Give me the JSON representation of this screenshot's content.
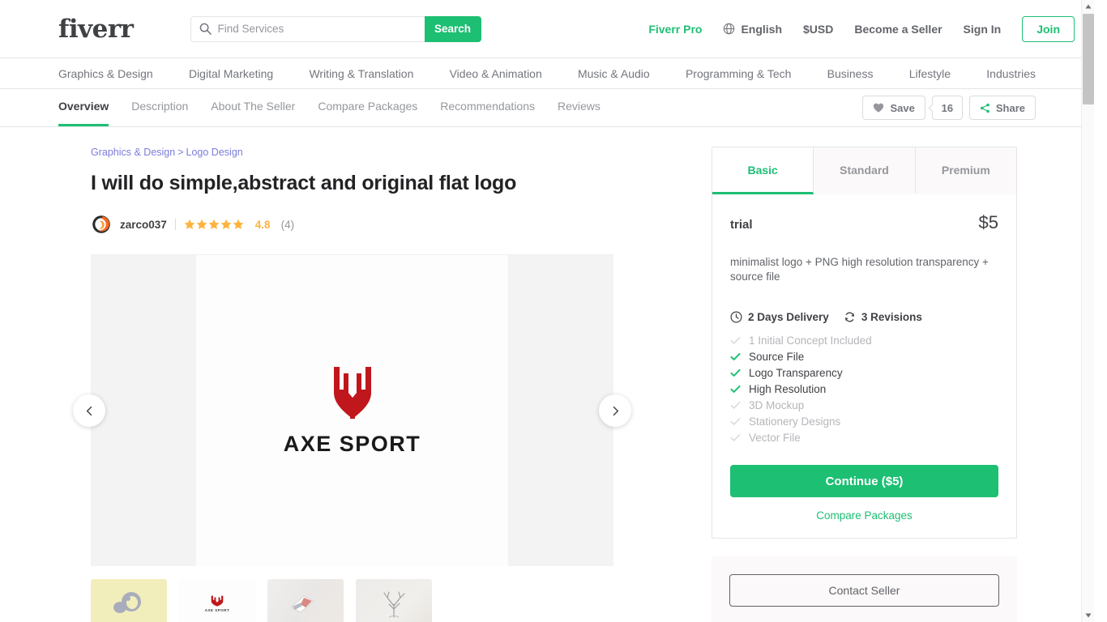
{
  "header": {
    "logo": "fiverr",
    "search": {
      "placeholder": "Find Services",
      "value": "",
      "button": "Search",
      "icon": "search-icon"
    },
    "nav": [
      {
        "label": "Fiverr Pro",
        "style": "pro"
      },
      {
        "label": "English",
        "icon": "globe-icon"
      },
      {
        "label": "$USD"
      },
      {
        "label": "Become a Seller"
      },
      {
        "label": "Sign In"
      }
    ],
    "join": "Join"
  },
  "categories": [
    "Graphics & Design",
    "Digital Marketing",
    "Writing & Translation",
    "Video & Animation",
    "Music & Audio",
    "Programming & Tech",
    "Business",
    "Lifestyle",
    "Industries"
  ],
  "gig_tabs": {
    "items": [
      {
        "label": "Overview",
        "active": true
      },
      {
        "label": "Description",
        "active": false
      },
      {
        "label": "About The Seller",
        "active": false
      },
      {
        "label": "Compare Packages",
        "active": false
      },
      {
        "label": "Recommendations",
        "active": false
      },
      {
        "label": "Reviews",
        "active": false
      }
    ],
    "save_label": "Save",
    "save_count": "16",
    "share_label": "Share"
  },
  "breadcrumb": {
    "parent": "Graphics & Design",
    "separator": ">",
    "child": "Logo Design"
  },
  "gig": {
    "title": "I will do simple,abstract and original flat logo",
    "seller": "zarco037",
    "rating": "4.8",
    "review_count": "(4)",
    "star_count": 5,
    "star_color": "#ffb33e"
  },
  "gallery": {
    "logo_word": "AXE SPORT",
    "logo_color": "#c0171c",
    "prev_icon": "chevron-left-icon",
    "next_icon": "chevron-right-icon",
    "thumbnails": [
      {
        "name": "thumb-gorilla-logo",
        "active": true
      },
      {
        "name": "thumb-axe-sport-logo",
        "active": false
      },
      {
        "name": "thumb-logo-mockup",
        "active": false
      },
      {
        "name": "thumb-tree-sketch",
        "active": false
      }
    ]
  },
  "package": {
    "tabs": [
      {
        "label": "Basic",
        "active": true
      },
      {
        "label": "Standard",
        "active": false
      },
      {
        "label": "Premium",
        "active": false
      }
    ],
    "name": "trial",
    "price": "$5",
    "description": "minimalist logo + PNG high resolution transparency + source file",
    "delivery": "2 Days Delivery",
    "revisions": "3 Revisions",
    "features": [
      {
        "label": "1 Initial Concept Included",
        "included": false
      },
      {
        "label": "Source File",
        "included": true
      },
      {
        "label": "Logo Transparency",
        "included": true
      },
      {
        "label": "High Resolution",
        "included": true
      },
      {
        "label": "3D Mockup",
        "included": false
      },
      {
        "label": "Stationery Designs",
        "included": false
      },
      {
        "label": "Vector File",
        "included": false
      }
    ],
    "continue_label": "Continue ($5)",
    "compare_label": "Compare Packages",
    "contact_label": "Contact Seller"
  },
  "colors": {
    "brand_green": "#1dbf73",
    "link_blue": "#7a7ddb",
    "text_dark": "#404145"
  }
}
